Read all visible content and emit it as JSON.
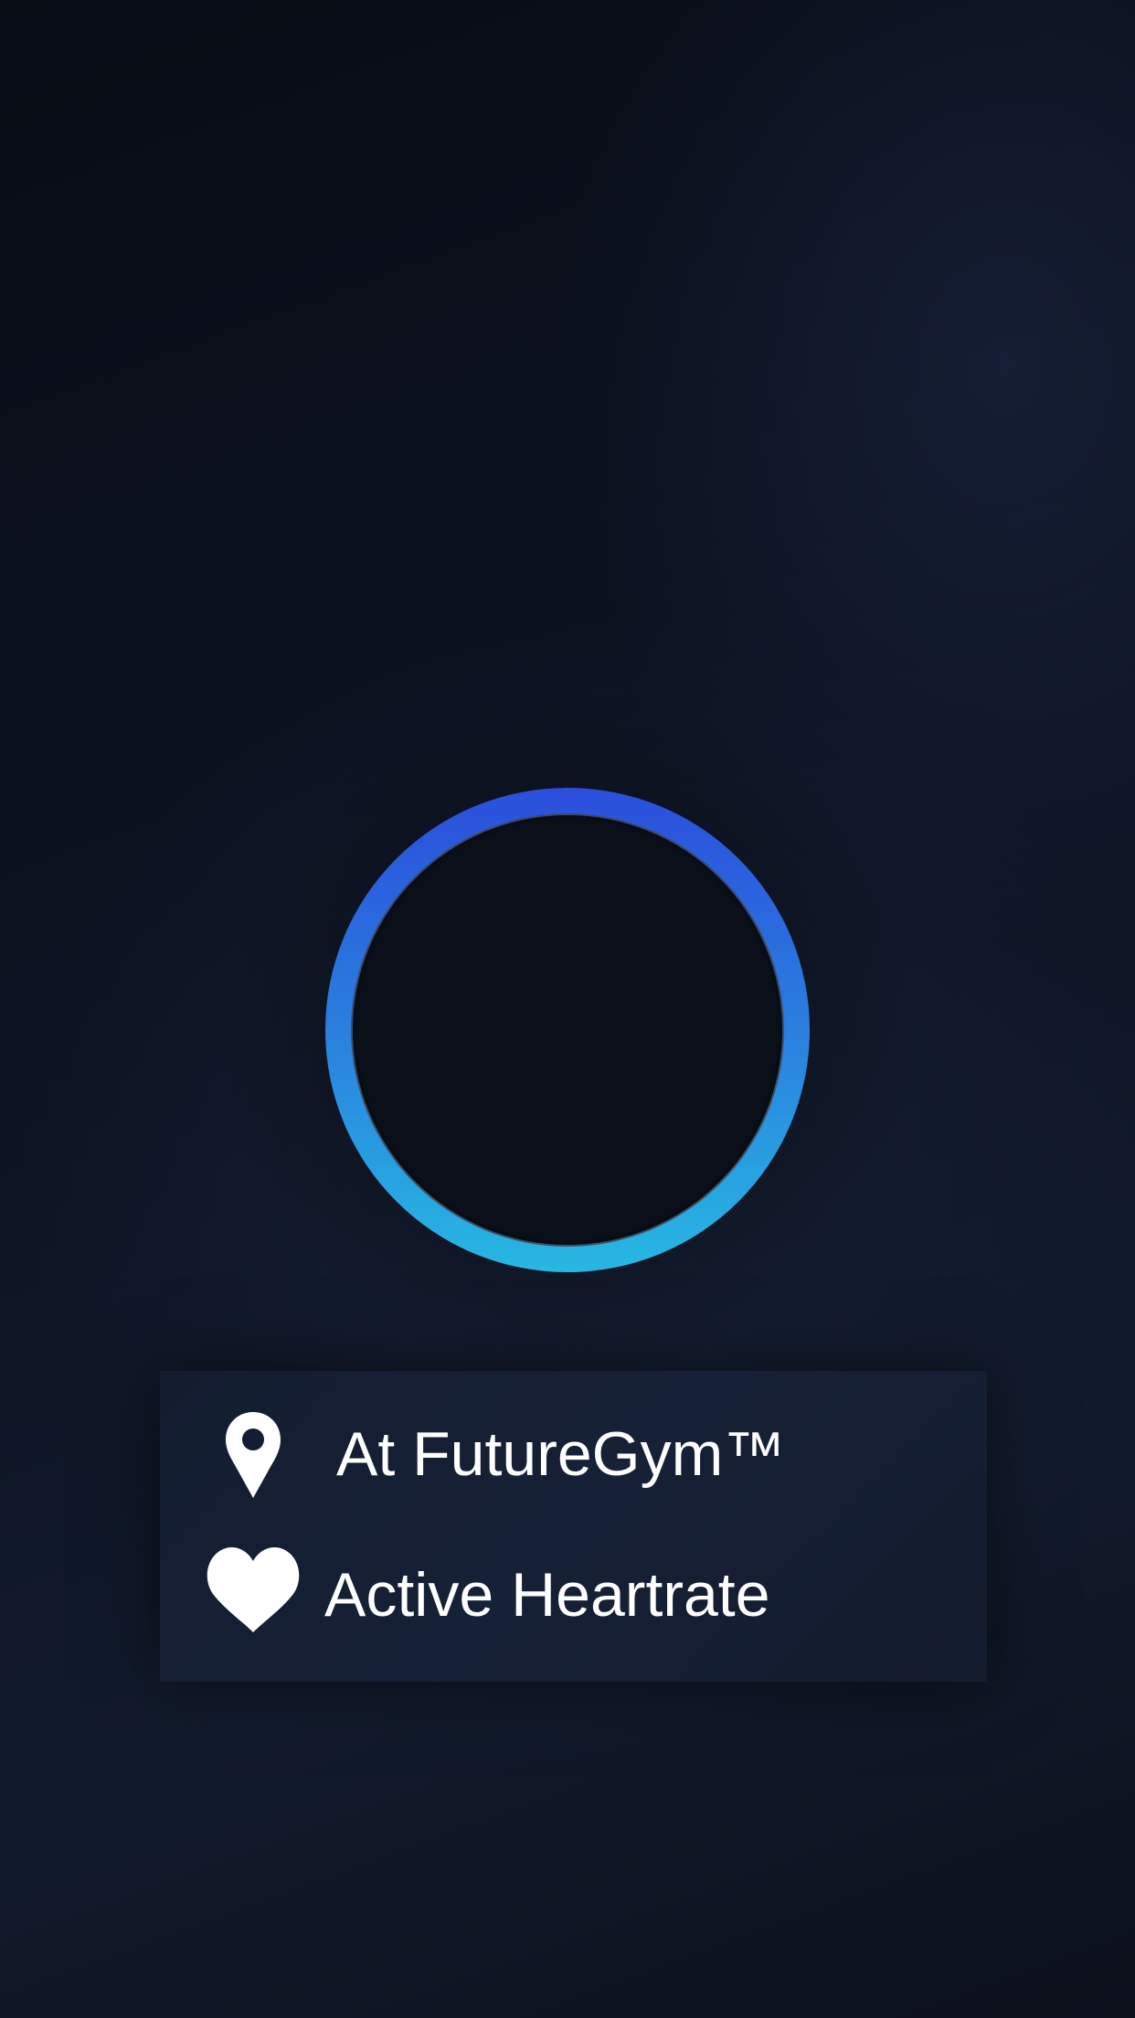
{
  "status_ring": {
    "colors": {
      "ring_top": "#2b4edc",
      "ring_bottom": "#27b8e2",
      "ring_center": "#0b101b"
    }
  },
  "info_card": {
    "rows": [
      {
        "icon": "location-pin-icon",
        "label": "At FutureGym™"
      },
      {
        "icon": "heart-icon",
        "label": "Active Heartrate"
      }
    ]
  },
  "colors": {
    "background": "#0c1322",
    "card_background": "#151e32",
    "text": "#ffffff"
  }
}
